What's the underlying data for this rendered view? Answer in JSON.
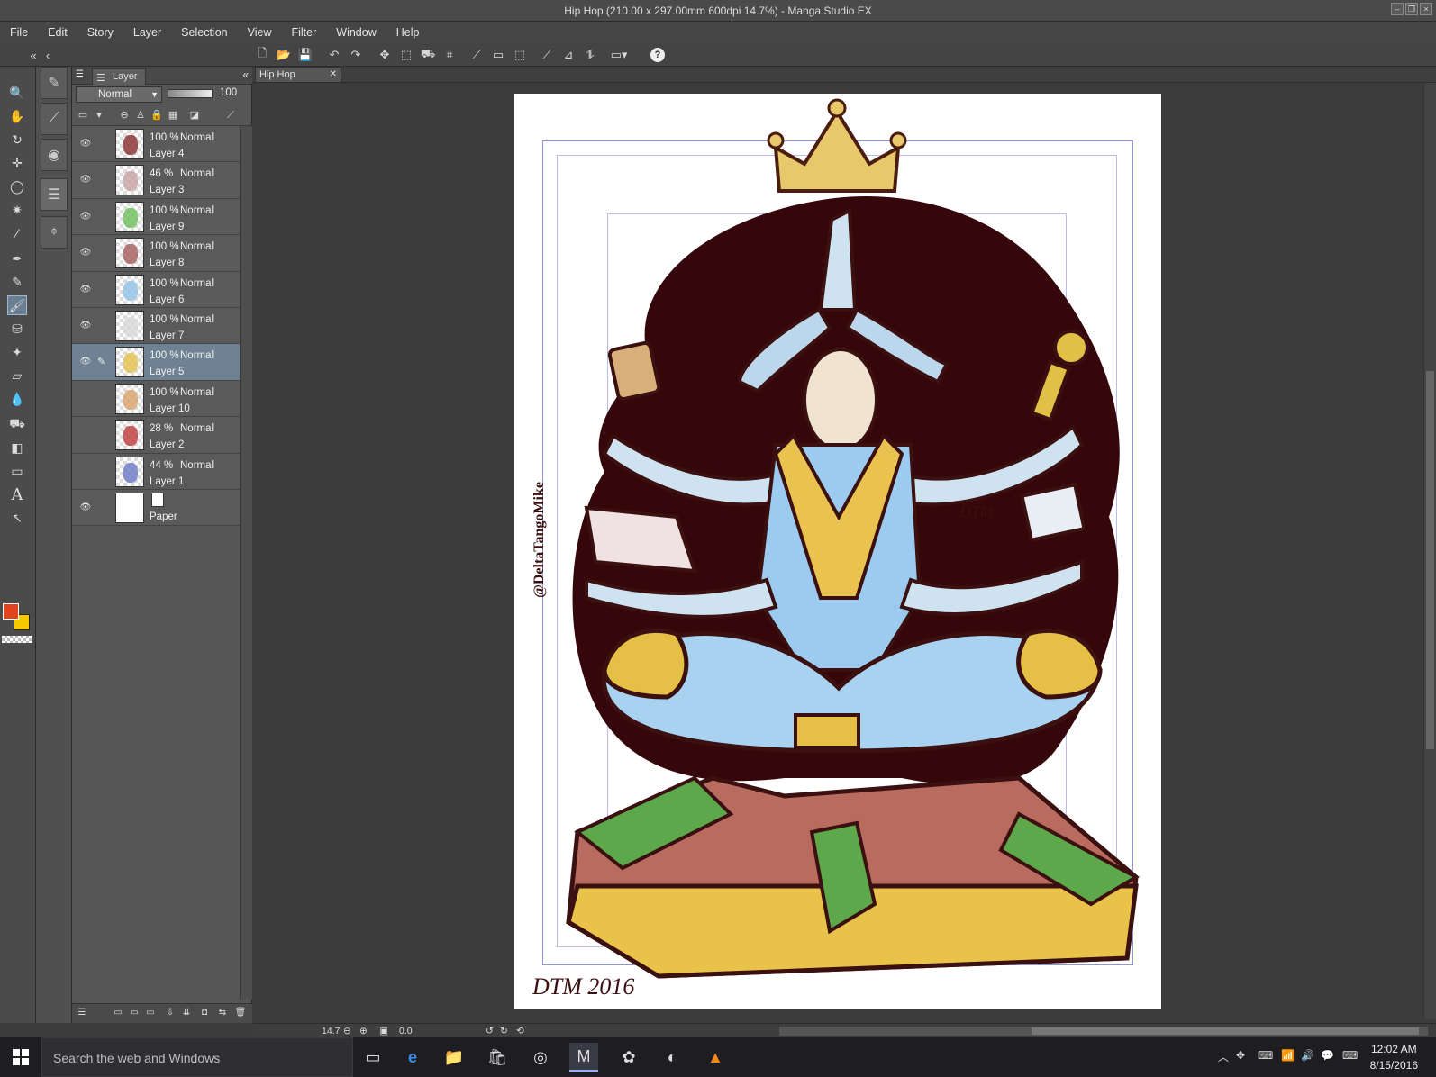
{
  "window": {
    "title": "Hip Hop (210.00 x 297.00mm 600dpi 14.7%)  - Manga Studio EX"
  },
  "menu": [
    "File",
    "Edit",
    "Story",
    "Layer",
    "Selection",
    "View",
    "Filter",
    "Window",
    "Help"
  ],
  "layer_panel": {
    "tab_label": "Layer",
    "blend_mode": "Normal",
    "opacity": "100",
    "layers": [
      {
        "opacity": "100 %",
        "mode": "Normal",
        "name": "Layer 4",
        "visible": true,
        "selected": false,
        "color": "#8a2c2c"
      },
      {
        "opacity": "46 %",
        "mode": "Normal",
        "name": "Layer 3",
        "visible": true,
        "selected": false,
        "color": "#c9a2a2"
      },
      {
        "opacity": "100 %",
        "mode": "Normal",
        "name": "Layer 9",
        "visible": true,
        "selected": false,
        "color": "#6cbf5a"
      },
      {
        "opacity": "100 %",
        "mode": "Normal",
        "name": "Layer 8",
        "visible": true,
        "selected": false,
        "color": "#a55b5b"
      },
      {
        "opacity": "100 %",
        "mode": "Normal",
        "name": "Layer 6",
        "visible": true,
        "selected": false,
        "color": "#8ec3e8"
      },
      {
        "opacity": "100 %",
        "mode": "Normal",
        "name": "Layer 7",
        "visible": true,
        "selected": false,
        "color": "#d8d8d8"
      },
      {
        "opacity": "100 %",
        "mode": "Normal",
        "name": "Layer 5",
        "visible": true,
        "selected": true,
        "color": "#e4c14a"
      },
      {
        "opacity": "100 %",
        "mode": "Normal",
        "name": "Layer 10",
        "visible": false,
        "selected": false,
        "color": "#d9a36a"
      },
      {
        "opacity": "28 %",
        "mode": "Normal",
        "name": "Layer 2",
        "visible": false,
        "selected": false,
        "color": "#c03a3a"
      },
      {
        "opacity": "44 %",
        "mode": "Normal",
        "name": "Layer 1",
        "visible": false,
        "selected": false,
        "color": "#6a78c9"
      }
    ],
    "paper_layer": {
      "name": "Paper"
    }
  },
  "document": {
    "tab_label": "Hip Hop"
  },
  "status": {
    "zoom": "14.7",
    "angle": "0.0"
  },
  "colors": {
    "foreground": "#e1441c",
    "background": "#f5c900",
    "selected_layer": "#6e8294"
  },
  "taskbar": {
    "search_placeholder": "Search the web and Windows",
    "time": "12:02 AM",
    "date": "8/15/2016"
  }
}
